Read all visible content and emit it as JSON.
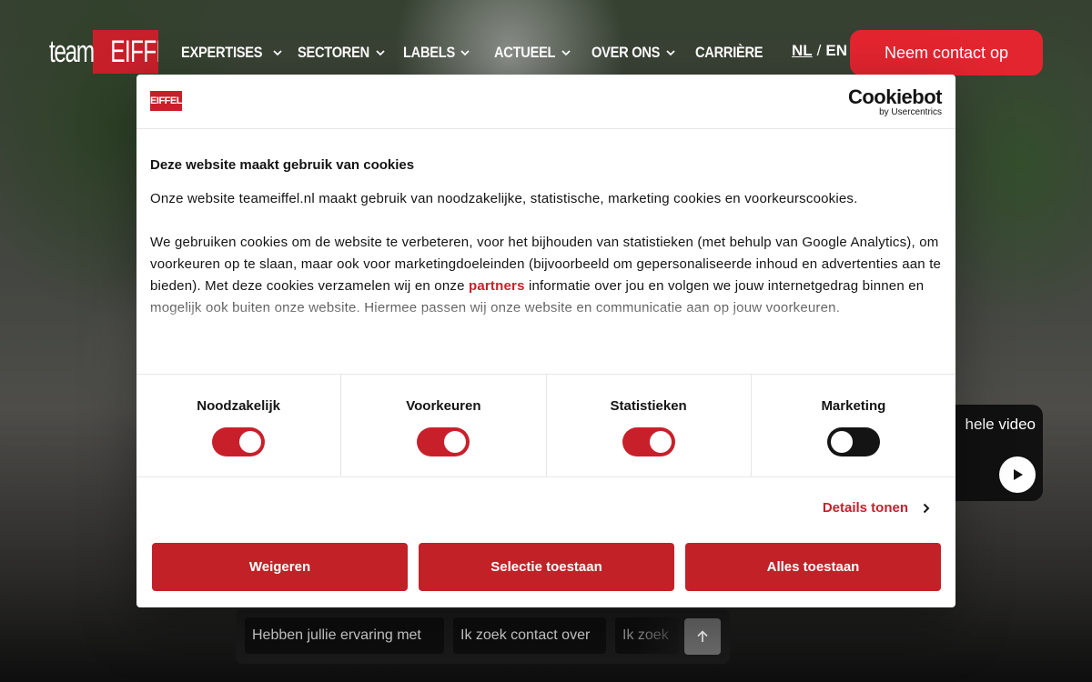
{
  "header": {
    "logo": {
      "team": "team",
      "brand": "EIFFEL"
    },
    "nav": [
      {
        "label": "EXPERTISES",
        "has_dropdown": true
      },
      {
        "label": "SECTOREN",
        "has_dropdown": true
      },
      {
        "label": "LABELS",
        "has_dropdown": true
      },
      {
        "label": "ACTUEEL",
        "has_dropdown": true
      },
      {
        "label": "OVER ONS",
        "has_dropdown": true
      },
      {
        "label": "CARRIÈRE",
        "has_dropdown": false
      }
    ],
    "lang": {
      "nl": "NL",
      "sep": "/",
      "en": "EN"
    },
    "cta": "Neem contact op"
  },
  "video": {
    "label": "hele video"
  },
  "chips": {
    "items": [
      "Hebben jullie ervaring met",
      "Ik zoek contact over",
      "Ik zoek"
    ]
  },
  "cookie_dialog": {
    "logo": "EIFFEL",
    "provider": {
      "name": "Cookiebot",
      "by": "by Usercentrics"
    },
    "title": "Deze website maakt gebruik van cookies",
    "intro": "Onze website teameiffel.nl maakt gebruik van noodzakelijke, statistische, marketing cookies en voorkeurscookies.",
    "body_before_link": "We gebruiken cookies om de website te verbeteren, voor het bijhouden van statistieken (met behulp van Google Analytics), om voorkeuren op te slaan, maar ook voor marketingdoeleinden (bijvoorbeeld om gepersonaliseerde inhoud en advertenties aan te bieden). Met deze cookies verzamelen wij en onze ",
    "link": "partners",
    "body_after_link": " informatie over jou en volgen we jouw internetgedrag binnen en mogelijk ook buiten onze website. Hiermee passen wij onze website en communicatie aan op jouw voorkeuren.",
    "toggles": [
      {
        "label": "Noodzakelijk",
        "on": true
      },
      {
        "label": "Voorkeuren",
        "on": true
      },
      {
        "label": "Statistieken",
        "on": true
      },
      {
        "label": "Marketing",
        "on": false
      }
    ],
    "details": "Details tonen",
    "buttons": {
      "deny": "Weigeren",
      "selection": "Selectie toestaan",
      "allow_all": "Alles toestaan"
    },
    "colors": {
      "accent": "#c8202b",
      "cta": "#e3252f"
    }
  }
}
